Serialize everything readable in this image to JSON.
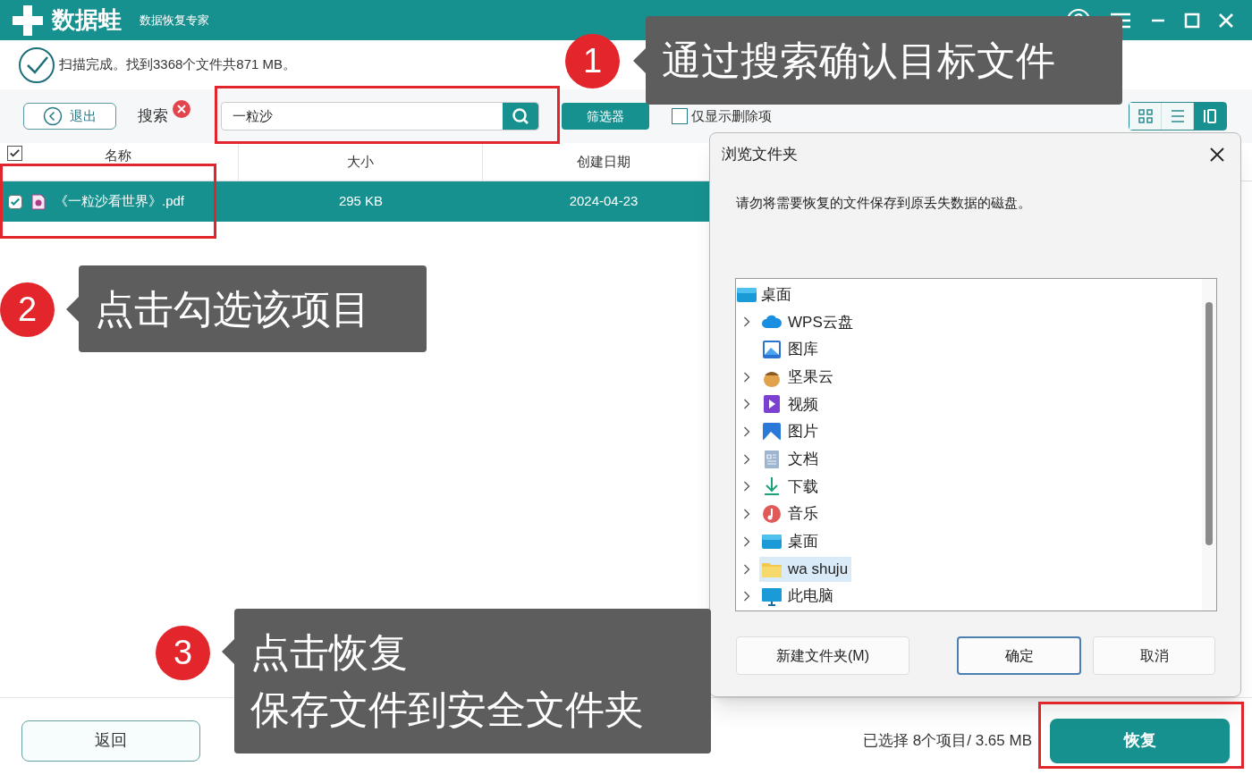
{
  "app": {
    "logo_text": "数据蛙",
    "subtitle": "数据恢复专家"
  },
  "status": "扫描完成。找到3368个文件共871 MB。",
  "toolbar": {
    "exit_button": "退出",
    "search_label": "搜索",
    "search_value": "一粒沙",
    "filter_button": "筛选器",
    "deleted_only": {
      "label": "仅显示删除项",
      "checked": false
    },
    "views": [
      {
        "kind": "grid",
        "selected": false
      },
      {
        "kind": "list",
        "selected": false
      },
      {
        "kind": "columns",
        "selected": true
      }
    ]
  },
  "table": {
    "select_all_checked": true,
    "columns": [
      "名称",
      "大小",
      "创建日期"
    ],
    "rows": [
      {
        "name": "《一粒沙看世界》.pdf",
        "size": "295 KB",
        "date": "2024-04-23",
        "checked": true,
        "selected": true
      }
    ]
  },
  "footer": {
    "back_button": "返回",
    "selection_summary": "已选择 8个项目/ 3.65 MB",
    "recover_button": "恢复"
  },
  "dialog": {
    "title": "浏览文件夹",
    "message": "请勿将需要恢复的文件保存到原丢失数据的磁盘。",
    "tree": {
      "label": "桌面",
      "kind": "desktop",
      "children": [
        {
          "label": "WPS云盘",
          "kind": "cloud",
          "expandable": true,
          "selected": false
        },
        {
          "label": "图库",
          "kind": "gallery",
          "expandable": false,
          "selected": false
        },
        {
          "label": "坚果云",
          "kind": "nut",
          "expandable": true,
          "selected": false
        },
        {
          "label": "视频",
          "kind": "video",
          "expandable": true,
          "selected": false
        },
        {
          "label": "图片",
          "kind": "pictures",
          "expandable": true,
          "selected": false
        },
        {
          "label": "文档",
          "kind": "documents",
          "expandable": true,
          "selected": false
        },
        {
          "label": "下载",
          "kind": "download",
          "expandable": true,
          "selected": false
        },
        {
          "label": "音乐",
          "kind": "music",
          "expandable": true,
          "selected": false
        },
        {
          "label": "桌面",
          "kind": "desktop",
          "expandable": true,
          "selected": false
        },
        {
          "label": "wa shuju",
          "kind": "folder",
          "expandable": true,
          "selected": true
        },
        {
          "label": "此电脑",
          "kind": "computer",
          "expandable": true,
          "selected": false
        }
      ]
    },
    "buttons": [
      {
        "label": "新建文件夹(M)",
        "default": false
      },
      {
        "label": "确定",
        "default": true
      },
      {
        "label": "取消",
        "default": false
      }
    ]
  },
  "annotations": [
    {
      "number": "1",
      "lines": [
        "通过搜索确认目标文件"
      ]
    },
    {
      "number": "2",
      "lines": [
        "点击勾选该项目"
      ]
    },
    {
      "number": "3",
      "lines": [
        "点击恢复",
        "保存文件到安全文件夹"
      ]
    }
  ]
}
